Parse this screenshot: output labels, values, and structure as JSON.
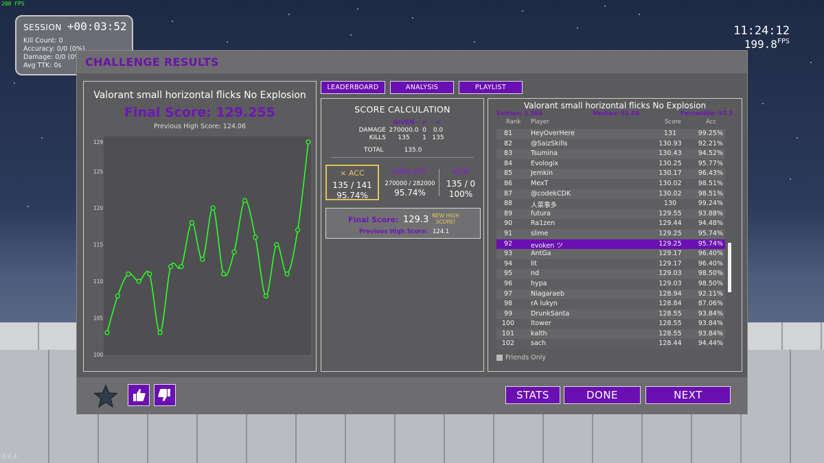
{
  "hud": {
    "fps_small": "200 FPS",
    "version": "3.0.4",
    "session_title": "SESSION",
    "session_time": "+00:03:52",
    "stats": [
      "Kill Count: 0",
      "Accuracy: 0/0 (0%)",
      "Damage: 0/0 (0%)",
      "Avg TTK: 0s"
    ],
    "clock": "11:24:12",
    "fps_value": "199.8",
    "fps_unit": "FPS"
  },
  "window": {
    "title": "CHALLENGE RESULTS"
  },
  "chart_panel": {
    "scenario": "Valorant small horizontal flicks No Explosion",
    "final_score": "Final Score: 129.255",
    "previous_high": "Previous High Score: 124.06"
  },
  "chart_data": {
    "type": "line",
    "series": [
      {
        "values": [
          103,
          108,
          111,
          110,
          111,
          103,
          112,
          112,
          118,
          113,
          120,
          111,
          114,
          121,
          116,
          108,
          115,
          111,
          117,
          129
        ]
      }
    ],
    "y_ticks": [
      100,
      105,
      110,
      115,
      120,
      125,
      129
    ],
    "ylim": [
      100,
      129
    ],
    "color": "#2bff2b"
  },
  "tabs": [
    "LEADERBOARD",
    "ANALYSIS",
    "PLAYLIST"
  ],
  "calc": {
    "title": "SCORE CALCULATION",
    "headers": [
      "",
      "GIVEN",
      "×",
      "="
    ],
    "rows": [
      [
        "DAMAGE",
        "270000.0",
        "0",
        "0.0"
      ],
      [
        "KILLS",
        "135",
        "1",
        "135"
      ]
    ],
    "total_label": "TOTAL",
    "total_value": "135.0",
    "metrics": [
      {
        "label": "× ACC",
        "val1": "135 / 141",
        "val2": "95.74%"
      },
      {
        "label": "DMG EFF",
        "val1": "270000 / 282000",
        "val2": "95.74%"
      },
      {
        "label": "KDR",
        "val1": "135 / 0",
        "val2": "100%"
      }
    ],
    "final_label": "Final Score:",
    "final_value": "129.3",
    "new_high": "NEW HIGH SCORE!",
    "prev_label": "Previous High Score:",
    "prev_value": "124.1"
  },
  "leaderboard": {
    "title": "Valorant small horizontal flicks No Explosion",
    "entries": "Entries: 3,366",
    "median": "Median: 91.09",
    "percentile": "Percentile: 97.3",
    "columns": [
      "Rank",
      "Player",
      "Score",
      "Acc"
    ],
    "rows": [
      [
        "81",
        "HeyOverHere",
        "131",
        "99.25%"
      ],
      [
        "82",
        "@SaizSkills",
        "130.93",
        "92.21%"
      ],
      [
        "83",
        "Tsumina",
        "130.43",
        "94.52%"
      ],
      [
        "84",
        "Evologix",
        "130.25",
        "95.77%"
      ],
      [
        "85",
        "Jemkin",
        "130.17",
        "96.43%"
      ],
      [
        "86",
        "MexT",
        "130.02",
        "98.51%"
      ],
      [
        "87",
        "@codekCDK",
        "130.02",
        "98.51%"
      ],
      [
        "88",
        "人菜事多",
        "130",
        "99.24%"
      ],
      [
        "89",
        "futura",
        "129.55",
        "93.88%"
      ],
      [
        "90",
        "Ra1zen",
        "129.44",
        "94.48%"
      ],
      [
        "91",
        "slime",
        "129.25",
        "95.74%"
      ],
      [
        "92",
        "evoken ツ",
        "129.25",
        "95.74%"
      ],
      [
        "93",
        "AntGa",
        "129.17",
        "96.40%"
      ],
      [
        "94",
        "lit",
        "129.17",
        "96.40%"
      ],
      [
        "95",
        "nd",
        "129.03",
        "98.50%"
      ],
      [
        "96",
        "hypa",
        "129.03",
        "98.50%"
      ],
      [
        "97",
        "Niagaraeb",
        "128.94",
        "92.11%"
      ],
      [
        "98",
        "rA lukyn",
        "128.84",
        "87.06%"
      ],
      [
        "99",
        "DrunkSanta",
        "128.55",
        "93.84%"
      ],
      [
        "100",
        "ltower",
        "128.55",
        "93.84%"
      ],
      [
        "101",
        "kalth",
        "128.55",
        "93.84%"
      ],
      [
        "102",
        "sach",
        "128.44",
        "94.44%"
      ]
    ],
    "highlight_rank": "92",
    "friends_only": "Friends Only"
  },
  "footer": {
    "stats": "STATS",
    "done": "DONE",
    "next": "NEXT"
  }
}
